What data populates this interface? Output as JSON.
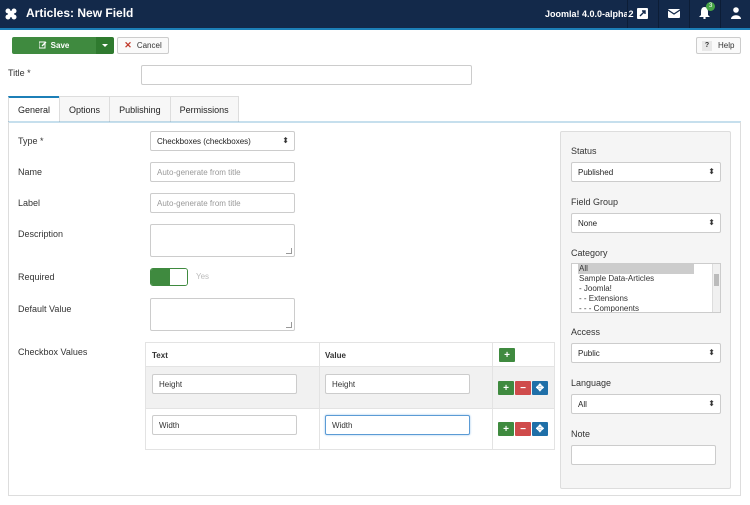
{
  "header": {
    "title": "Articles: New Field",
    "version": "Joomla! 4.0.0-alpha2",
    "notifications_count": "3",
    "icons": [
      "joomla-logo-icon",
      "external-link-icon",
      "mail-icon",
      "bell-icon",
      "user-icon"
    ]
  },
  "toolbar": {
    "save_label": "Save",
    "cancel_label": "Cancel",
    "help_label": "Help",
    "help_icon_text": "?"
  },
  "form": {
    "title_label": "Title *",
    "title_value": ""
  },
  "tabs": [
    {
      "label": "General",
      "active": true
    },
    {
      "label": "Options",
      "active": false
    },
    {
      "label": "Publishing",
      "active": false
    },
    {
      "label": "Permissions",
      "active": false
    }
  ],
  "general": {
    "type_label": "Type *",
    "type_value": "Checkboxes (checkboxes)",
    "name_label": "Name",
    "name_placeholder": "Auto-generate from title",
    "label_label": "Label",
    "label_placeholder": "Auto-generate from title",
    "description_label": "Description",
    "required_label": "Required",
    "required_toggle_text": "Yes",
    "default_value_label": "Default Value",
    "checkbox_values_label": "Checkbox Values",
    "table": {
      "col_text": "Text",
      "col_value": "Value",
      "rows": [
        {
          "text": "Height",
          "value": "Height"
        },
        {
          "text": "Width",
          "value": "Width"
        }
      ]
    }
  },
  "sidebar": {
    "status_label": "Status",
    "status_value": "Published",
    "field_group_label": "Field Group",
    "field_group_value": "None",
    "category_label": "Category",
    "category_options": [
      "All",
      "Sample Data-Articles",
      "- Joomla!",
      "- - Extensions",
      "- - - Components"
    ],
    "access_label": "Access",
    "access_value": "Public",
    "language_label": "Language",
    "language_value": "All",
    "note_label": "Note",
    "note_value": ""
  },
  "colors": {
    "header_bg": "#13294a",
    "accent": "#1c7fb7",
    "success": "#3f8a3f",
    "danger": "#cf4b4b",
    "primary": "#1f6fa8"
  }
}
